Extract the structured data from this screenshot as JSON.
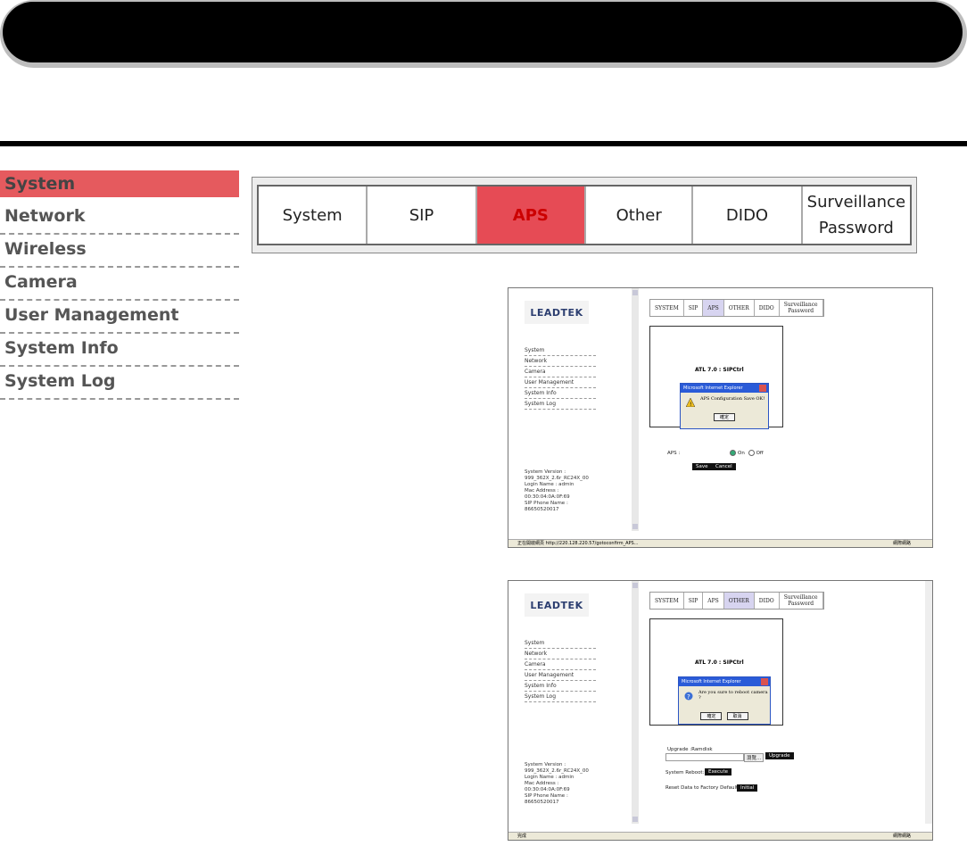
{
  "sidebar": {
    "items": [
      {
        "label": "System",
        "active": true
      },
      {
        "label": "Network",
        "active": false
      },
      {
        "label": "Wireless",
        "active": false
      },
      {
        "label": "Camera",
        "active": false
      },
      {
        "label": "User Management",
        "active": false
      },
      {
        "label": "System Info",
        "active": false
      },
      {
        "label": "System Log",
        "active": false
      }
    ]
  },
  "tabs": {
    "items": [
      {
        "label": "System"
      },
      {
        "label": "SIP"
      },
      {
        "label": "APS",
        "active": true
      },
      {
        "label": "Other"
      },
      {
        "label": "DIDO"
      },
      {
        "label": "Surveillance\nPassword"
      }
    ]
  },
  "colors": {
    "active_red": "#e64b55",
    "sidebar_active": "#e55a5e"
  },
  "shot_common": {
    "logo": "LEADTEK",
    "nav": [
      "System",
      "Network",
      "Camera",
      "User Management",
      "System Info",
      "System Log"
    ],
    "info": [
      "System Version :",
      "999_362X_2.6r_RC24X_00",
      "Login Name : admin",
      "Mac Address :",
      "00:30:04:0A:0F:69",
      "SIP Phone Name :",
      "86650520017"
    ],
    "tabs": [
      "SYSTEM",
      "SIP",
      "APS",
      "OTHER",
      "DIDO",
      "Surveillance\nPassword"
    ],
    "panel_title": "ATL 7.0 : SIPCtrl",
    "dialog_title": "Microsoft Internet Explorer"
  },
  "shot1": {
    "dialog_msg": "APS Configuration Save OK!",
    "ok": "確定",
    "aps_label": "APS :",
    "on": "On",
    "off": "Off",
    "save": "Save",
    "cancel": "Cancel",
    "status": "正在開啟網頁 http://220.128.220.57/gotoconfirm_APS...",
    "zone": "網際網路"
  },
  "shot2": {
    "dialog_msg": "Are you sure to reboot camera ?",
    "ok": "確定",
    "cancel_btn": "取消",
    "upgrade_label": "Upgrade :Ramdisk",
    "browse": "瀏覽...",
    "upgrade": "Upgrade",
    "reboot_label": "System Reboot:",
    "execute": "Execute",
    "reset_label": "Reset Data to Factory Default:",
    "initial": "Initial",
    "status": "完成",
    "zone": "網際網路"
  }
}
